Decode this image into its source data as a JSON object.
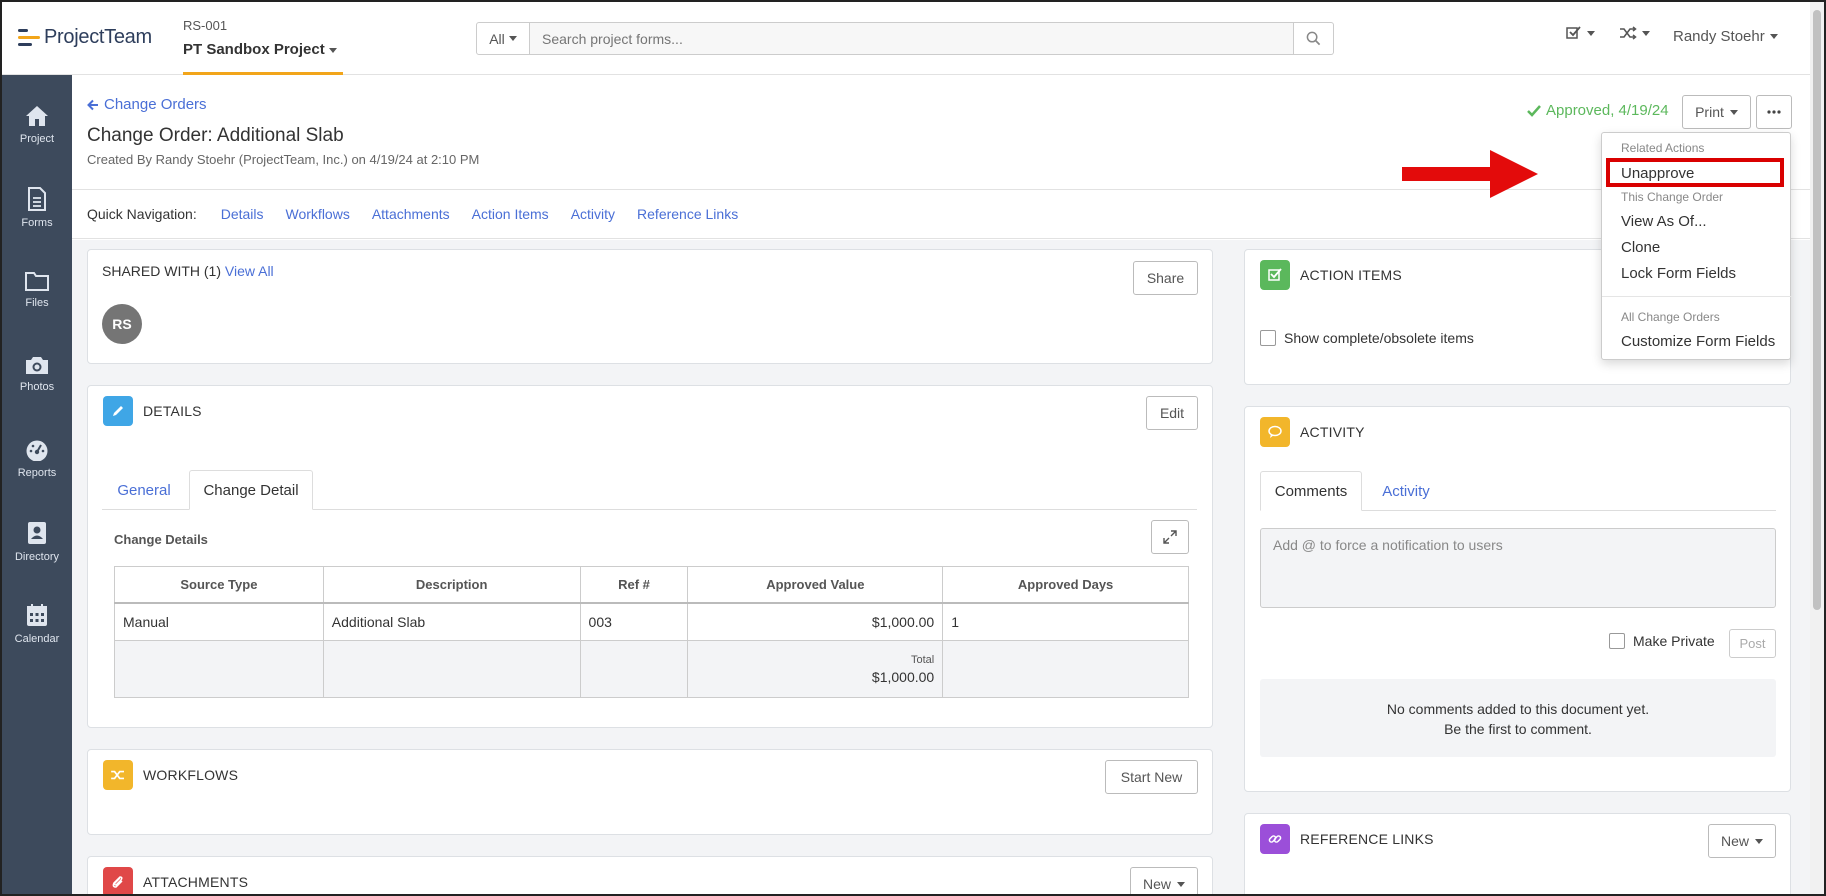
{
  "app": {
    "logo_text_light": "Project",
    "logo_text_bold": "Team",
    "project_code": "RS-001",
    "project_name": "PT Sandbox Project"
  },
  "search": {
    "scope": "All",
    "placeholder": "Search project forms..."
  },
  "user": {
    "name": "Randy Stoehr"
  },
  "nav": [
    {
      "label": "Project",
      "icon": "home-icon"
    },
    {
      "label": "Forms",
      "icon": "document-icon"
    },
    {
      "label": "Files",
      "icon": "folder-icon"
    },
    {
      "label": "Photos",
      "icon": "camera-icon"
    },
    {
      "label": "Reports",
      "icon": "dashboard-icon"
    },
    {
      "label": "Directory",
      "icon": "contact-book-icon"
    },
    {
      "label": "Calendar",
      "icon": "calendar-icon"
    }
  ],
  "header": {
    "back_link": "Change Orders",
    "title": "Change Order: Additional Slab",
    "created_by": "Created By Randy Stoehr (ProjectTeam, Inc.) on 4/19/24 at 2:10 PM",
    "status": "Approved, 4/19/24",
    "print_label": "Print"
  },
  "quick_nav": {
    "label": "Quick Navigation:",
    "links": [
      "Details",
      "Workflows",
      "Attachments",
      "Action Items",
      "Activity",
      "Reference Links"
    ]
  },
  "shared": {
    "title": "SHARED WITH (1)",
    "view_all": "View All",
    "share_label": "Share",
    "avatar_initials": "RS"
  },
  "details": {
    "title": "DETAILS",
    "edit_label": "Edit",
    "tabs": [
      "General",
      "Change Detail"
    ],
    "section_title": "Change Details",
    "columns": [
      "Source Type",
      "Description",
      "Ref #",
      "Approved Value",
      "Approved Days"
    ],
    "rows": [
      {
        "source_type": "Manual",
        "description": "Additional Slab",
        "ref": "003",
        "approved_value": "$1,000.00",
        "approved_days": "1"
      }
    ],
    "total_label": "Total",
    "total_value": "$1,000.00"
  },
  "workflows": {
    "title": "WORKFLOWS",
    "start_label": "Start New"
  },
  "attachments": {
    "title": "ATTACHMENTS",
    "new_label": "New"
  },
  "action_items": {
    "title": "ACTION ITEMS",
    "show_complete": "Show complete/obsolete items"
  },
  "activity": {
    "title": "ACTIVITY",
    "tabs": [
      "Comments",
      "Activity"
    ],
    "comment_placeholder": "Add @ to force a notification to users",
    "make_private": "Make Private",
    "post_label": "Post",
    "empty_line1": "No comments added to this document yet.",
    "empty_line2": "Be the first to comment."
  },
  "reference_links": {
    "title": "REFERENCE LINKS",
    "new_label": "New"
  },
  "dropdown": {
    "related_header": "Related Actions",
    "unapprove": "Unapprove",
    "this_header": "This Change Order",
    "view_as_of": "View As Of...",
    "clone": "Clone",
    "lock_fields": "Lock Form Fields",
    "all_header": "All Change Orders",
    "customize": "Customize Form Fields"
  },
  "colors": {
    "accent": "#f2a51a",
    "link": "#4a6fd6",
    "approved": "#5cb85c",
    "nav_bg": "#3d4a5c",
    "highlight": "#d90000"
  }
}
